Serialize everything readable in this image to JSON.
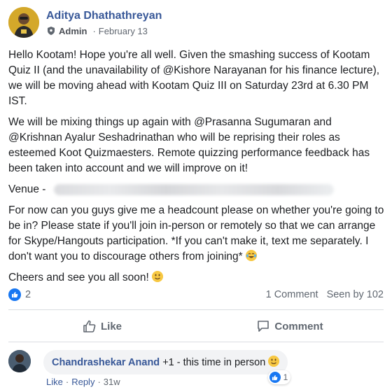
{
  "post": {
    "author": "Aditya Dhathathreyan",
    "role": "Admin",
    "date": "February 13",
    "paragraphs": {
      "p1": "Hello Kootam! Hope you're all well. Given the smashing success of Kootam Quiz II (and the unavailability of @Kishore Narayanan for his finance lecture), we will be moving ahead with Kootam Quiz III on Saturday 23rd at 6.30 PM IST.",
      "p2": "We will be mixing things up again with @Prasanna Sugumaran and @Krishnan Ayalur Seshadrinathan who will be reprising their roles as esteemed Koot Quizmaesters. Remote quizzing performance feedback has been taken into account and we will improve on it!",
      "venue_label": "Venue -",
      "p3": "For now can you guys give me a headcount please on whether you're going to be in? Please state if you'll join in-person or remotely so that we can arrange for Skype/Hangouts participation. *If you can't make it, text me separately. I don't want you to discourage others from joining*",
      "p4": "Cheers and see you all soon!"
    },
    "icons": {
      "admin": "shield-icon",
      "laugh_emoji": "tears-of-joy-emoji",
      "smile_emoji": "smiling-face-emoji"
    }
  },
  "stats": {
    "likes": "2",
    "comments": "1 Comment",
    "seen": "Seen by 102"
  },
  "actions": {
    "like": "Like",
    "comment": "Comment"
  },
  "comment": {
    "author": "Chandrashekar Anand",
    "text": "+1 - this time in person",
    "reaction_count": "1",
    "like_action": "Like",
    "reply_action": "Reply",
    "separator": "·",
    "age": "31w"
  },
  "colors": {
    "link": "#385898",
    "like_blue": "#1877f2",
    "text": "#1c1e21",
    "muted": "#606770",
    "bubble": "#f2f3f5"
  }
}
